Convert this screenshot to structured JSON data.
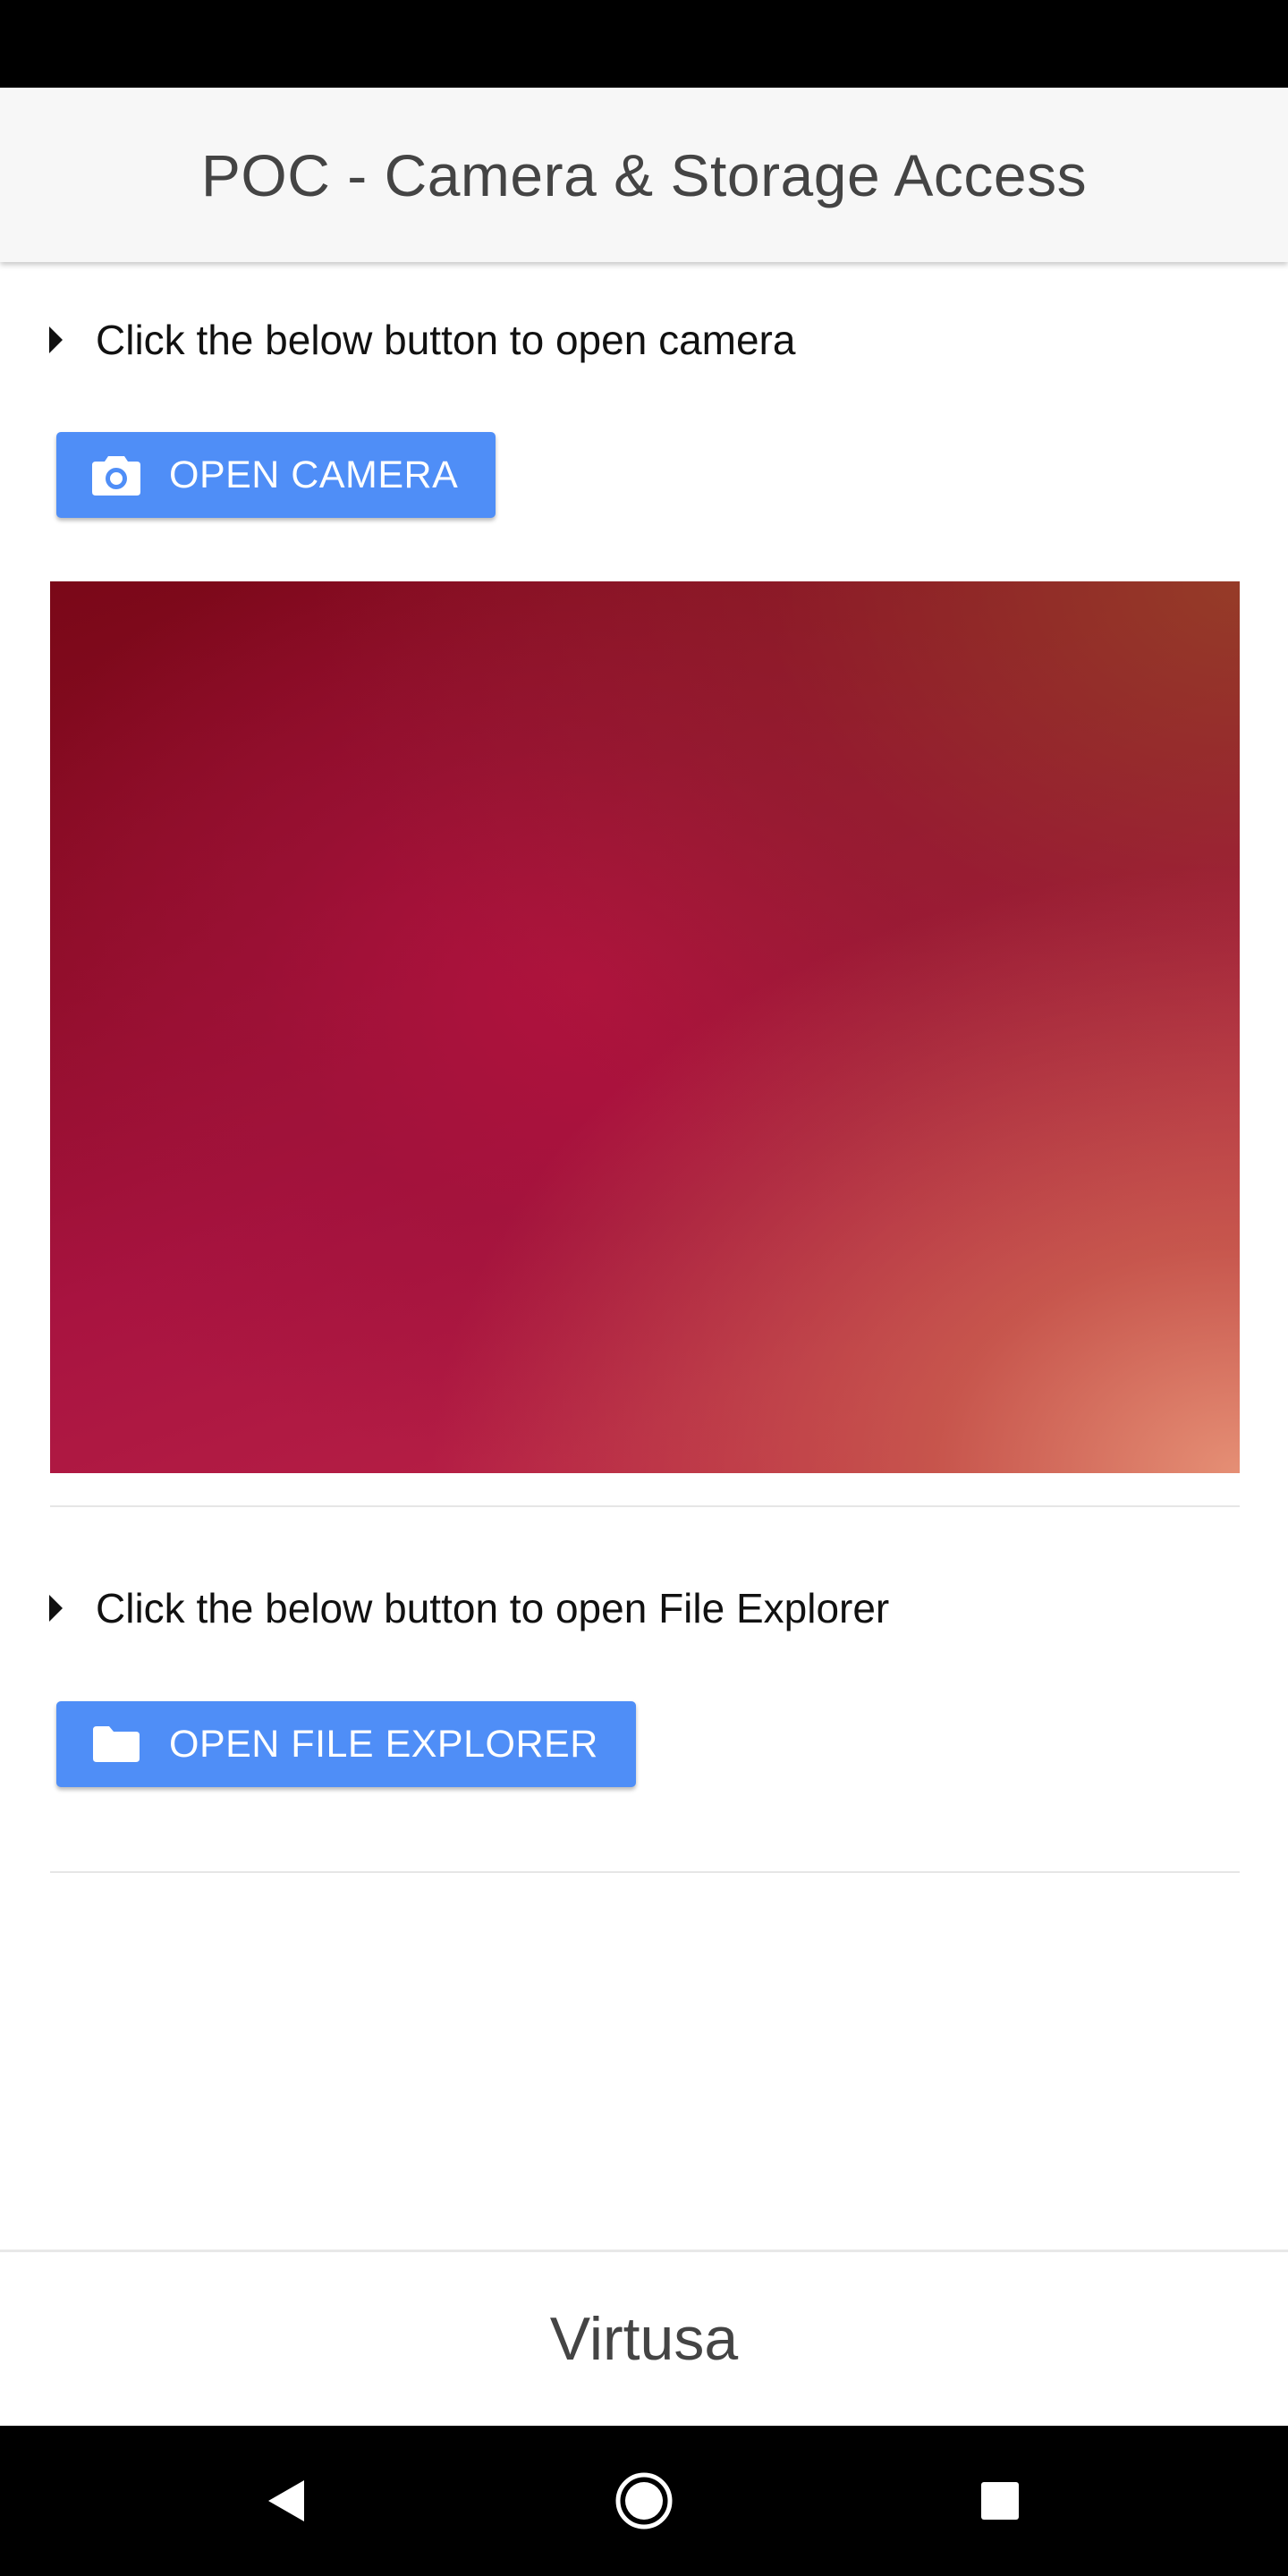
{
  "header": {
    "title": "POC - Camera & Storage Access"
  },
  "camera_section": {
    "instruction": "Click the below button to open camera",
    "button_label": "OPEN CAMERA",
    "button_icon": "camera-icon"
  },
  "file_section": {
    "instruction": "Click the below button to open File Explorer",
    "button_label": "OPEN FILE EXPLORER",
    "button_icon": "folder-icon"
  },
  "footer": {
    "title": "Virtusa"
  },
  "nav_bar": {
    "buttons": [
      "back-icon",
      "home-icon",
      "recents-icon"
    ]
  },
  "colors": {
    "button": "#4f8ef7",
    "header_bg": "#f7f7f7",
    "title_text": "#444444"
  }
}
